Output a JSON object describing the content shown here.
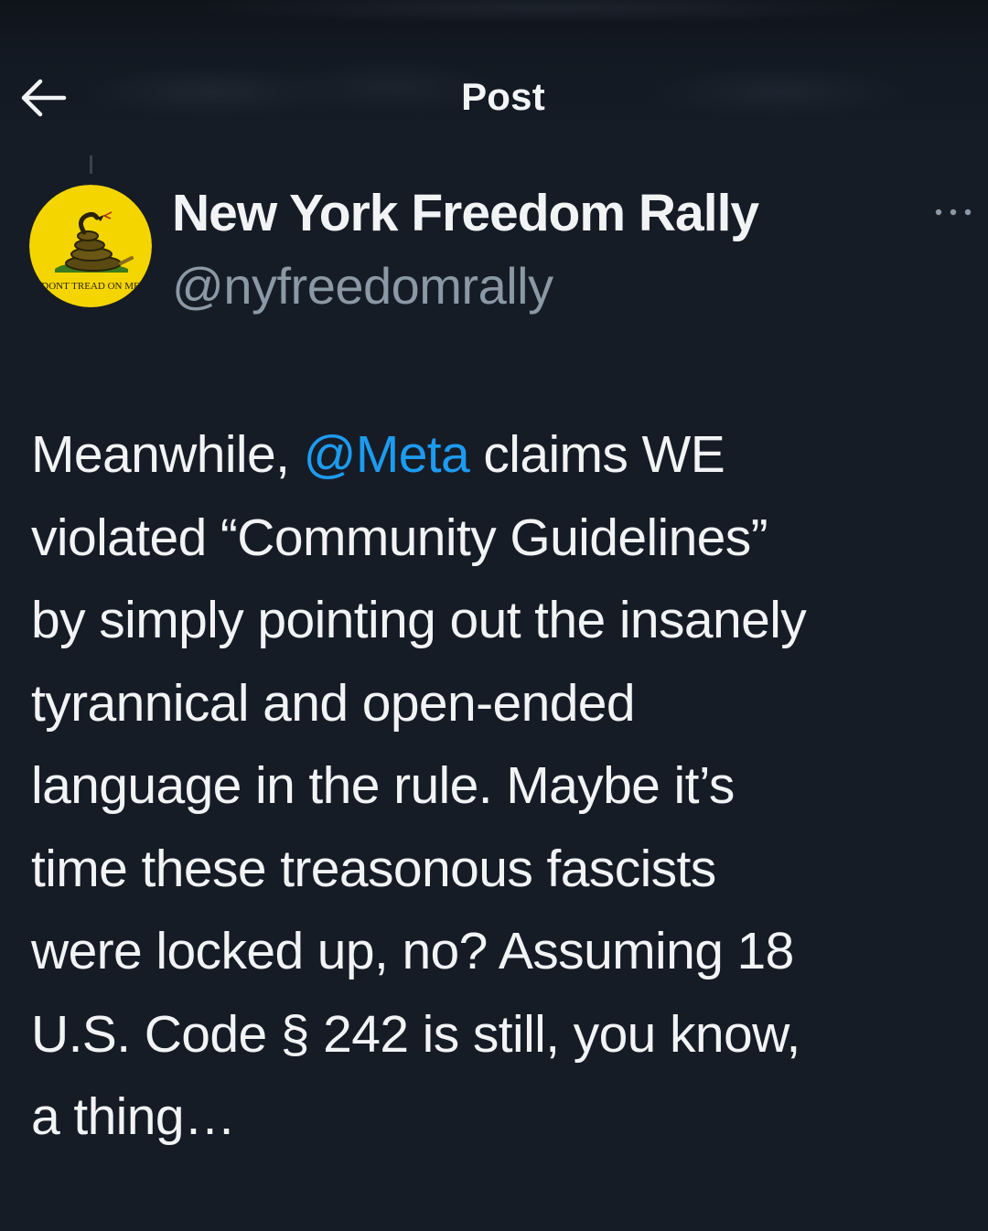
{
  "header": {
    "title": "Post",
    "back_icon": "arrow-left-icon"
  },
  "author": {
    "display_name": "New York Freedom Rally",
    "handle": "@nyfreedomrally",
    "avatar": {
      "description_icon": "gadsden-flag-avatar",
      "background_color": "#f4d500",
      "text": "DONT TREAD ON ME"
    },
    "more_icon": "more-horizontal-icon"
  },
  "post": {
    "lines": [
      {
        "before": "Meanwhile, ",
        "mention": "@Meta",
        "after": " claims WE"
      },
      {
        "text": "violated “Community Guidelines”"
      },
      {
        "text": "by simply pointing out the insanely"
      },
      {
        "text": "tyrannical and open-ended"
      },
      {
        "text": "language in the rule. Maybe it’s"
      },
      {
        "text": "time these treasonous fascists"
      },
      {
        "text": "were locked up, no? Assuming 18"
      },
      {
        "text": "U.S. Code § 242 is still, you know,"
      },
      {
        "text": "a thing…"
      }
    ]
  },
  "colors": {
    "background": "#161c26",
    "text": "#f2f3f4",
    "secondary_text": "#8b98a5",
    "link": "#1d9bf0"
  }
}
